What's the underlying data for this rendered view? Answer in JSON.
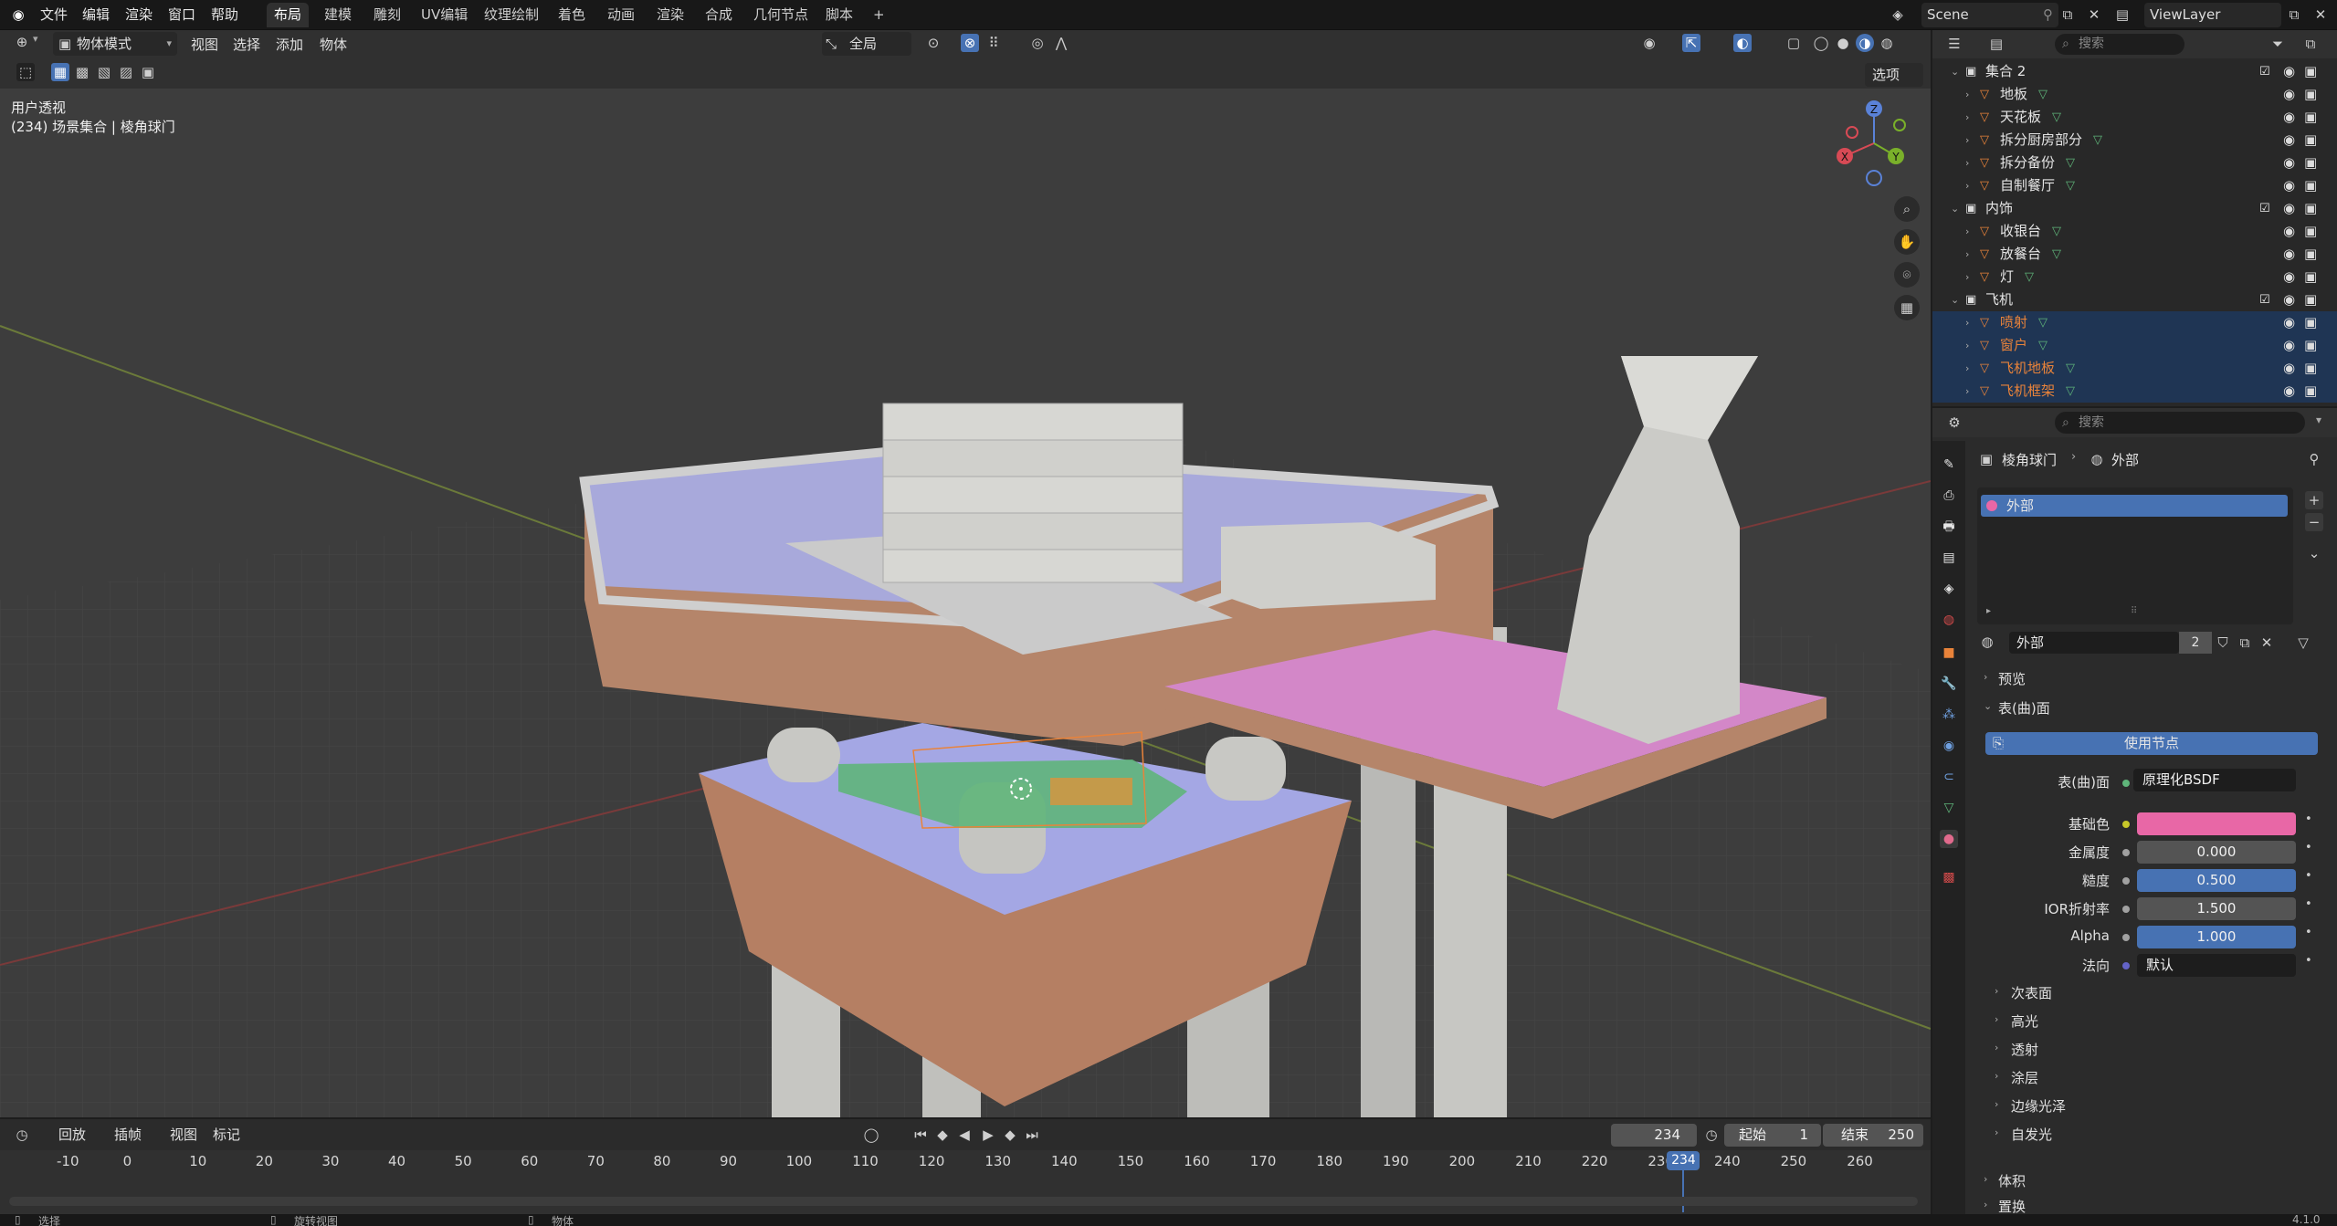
{
  "menubar": {
    "items": [
      "文件",
      "编辑",
      "渲染",
      "窗口",
      "帮助"
    ],
    "workspaces": [
      "布局",
      "建模",
      "雕刻",
      "UV编辑",
      "纹理绘制",
      "着色",
      "动画",
      "渲染",
      "合成",
      "几何节点",
      "脚本"
    ],
    "add_tab": "+",
    "scene": "Scene",
    "view_layer": "ViewLayer"
  },
  "viewport_header": {
    "mode": "物体模式",
    "menus": [
      "视图",
      "选择",
      "添加",
      "物体"
    ],
    "transform_orientation": "全局",
    "options": "选项"
  },
  "viewport": {
    "view_name": "用户透视",
    "context": "(234) 场景集合 | 棱角球门",
    "gizmo_axes": [
      "X",
      "Y",
      "Z"
    ]
  },
  "outliner": {
    "search_placeholder": "搜索",
    "rows": [
      {
        "name": "集合 2",
        "type": "collection",
        "selected": false
      },
      {
        "name": "地板",
        "type": "object",
        "selected": false
      },
      {
        "name": "天花板",
        "type": "object",
        "selected": false
      },
      {
        "name": "拆分厨房部分",
        "type": "object",
        "selected": false
      },
      {
        "name": "拆分备份",
        "type": "object",
        "selected": false
      },
      {
        "name": "自制餐厅",
        "type": "object",
        "selected": false
      },
      {
        "name": "内饰",
        "type": "collection",
        "selected": false
      },
      {
        "name": "收银台",
        "type": "object",
        "selected": false
      },
      {
        "name": "放餐台",
        "type": "object",
        "selected": false
      },
      {
        "name": "灯",
        "type": "object",
        "selected": false
      },
      {
        "name": "飞机",
        "type": "collection",
        "selected": false
      },
      {
        "name": "喷射",
        "type": "object",
        "selected": true
      },
      {
        "name": "窗户",
        "type": "object",
        "selected": true
      },
      {
        "name": "飞机地板",
        "type": "object",
        "selected": true
      },
      {
        "name": "飞机框架",
        "type": "object",
        "selected": true
      }
    ]
  },
  "properties": {
    "search_placeholder": "搜索",
    "breadcrumb_object": "棱角球门",
    "breadcrumb_material": "外部",
    "material_slot": "外部",
    "material_name": "外部",
    "user_count": "2",
    "sections": {
      "preview": "预览",
      "surface": "表(曲)面",
      "volume": "体积",
      "displacement": "置换"
    },
    "use_nodes": "使用节点",
    "surface_label": "表(曲)面",
    "surface_value": "原理化BSDF",
    "fields": [
      {
        "label": "基础色",
        "value": "",
        "kind": "color",
        "color": "#e867a6",
        "socket": "#c7c729"
      },
      {
        "label": "金属度",
        "value": "0.000",
        "kind": "gray",
        "socket": "#a1a1a1"
      },
      {
        "label": "糙度",
        "value": "0.500",
        "kind": "blue",
        "socket": "#a1a1a1"
      },
      {
        "label": "IOR折射率",
        "value": "1.500",
        "kind": "gray",
        "socket": "#a1a1a1"
      },
      {
        "label": "Alpha",
        "value": "1.000",
        "kind": "blue",
        "socket": "#a1a1a1"
      },
      {
        "label": "法向",
        "value": "默认",
        "kind": "dark",
        "socket": "#6363c7"
      }
    ],
    "subpanels": [
      "次表面",
      "高光",
      "透射",
      "涂层",
      "边缘光泽",
      "自发光"
    ]
  },
  "timeline": {
    "menus": [
      "回放",
      "插帧",
      "视图",
      "标记"
    ],
    "current_frame": "234",
    "start_label": "起始",
    "start": "1",
    "end_label": "结束",
    "end": "250",
    "ticks": [
      "-10",
      "0",
      "10",
      "20",
      "30",
      "40",
      "50",
      "60",
      "70",
      "80",
      "90",
      "100",
      "110",
      "120",
      "130",
      "140",
      "150",
      "160",
      "170",
      "180",
      "190",
      "200",
      "210",
      "220",
      "230",
      "240",
      "250",
      "260"
    ],
    "playhead": "234"
  },
  "statusbar": {
    "items": [
      "选择",
      "旋转视图",
      "物体"
    ],
    "version": "4.1.0"
  },
  "colors": {
    "accent_blue": "#4772b3",
    "selection_row": "#1f3554",
    "object_orange": "#e9833a",
    "mesh_green": "#5fb57a"
  }
}
